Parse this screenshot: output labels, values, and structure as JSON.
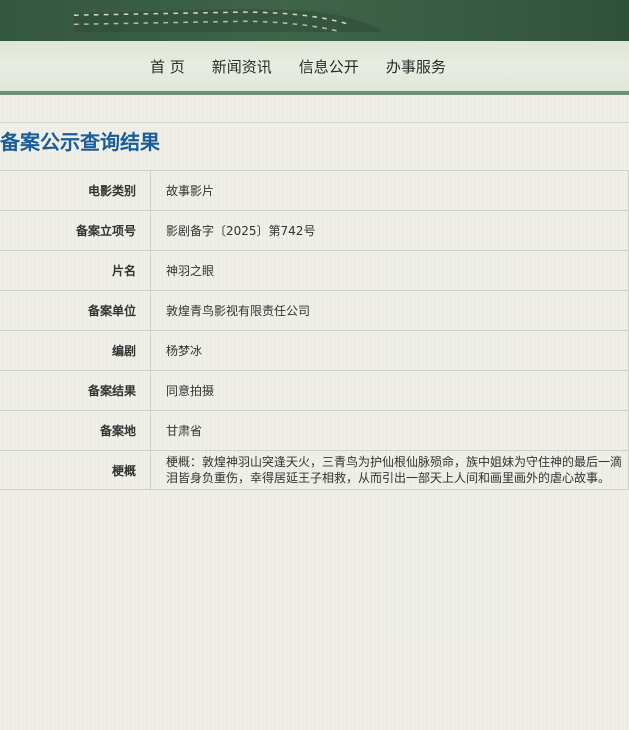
{
  "nav": {
    "items": [
      "首 页",
      "新闻资讯",
      "信息公开",
      "办事服务"
    ]
  },
  "page": {
    "title": "备案公示查询结果"
  },
  "record": {
    "rows": [
      {
        "label": "电影类别",
        "value": "故事影片"
      },
      {
        "label": "备案立项号",
        "value": "影剧备字〔2025〕第742号"
      },
      {
        "label": "片名",
        "value": "神羽之眼"
      },
      {
        "label": "备案单位",
        "value": "敦煌青鸟影视有限责任公司"
      },
      {
        "label": "编剧",
        "value": "杨梦冰"
      },
      {
        "label": "备案结果",
        "value": "同意拍摄"
      },
      {
        "label": "备案地",
        "value": "甘肃省"
      },
      {
        "label": "梗概",
        "value": "梗概：敦煌神羽山突逢天火，三青鸟为护仙根仙脉殒命，族中姐妹为守住神的最后一滴泪皆身负重伤，幸得居延王子相救，从而引出一部天上人间和画里画外的虐心故事。"
      }
    ]
  },
  "colors": {
    "banner": "#3f6448",
    "title": "#1a5e95",
    "label": "#1a5e95"
  }
}
